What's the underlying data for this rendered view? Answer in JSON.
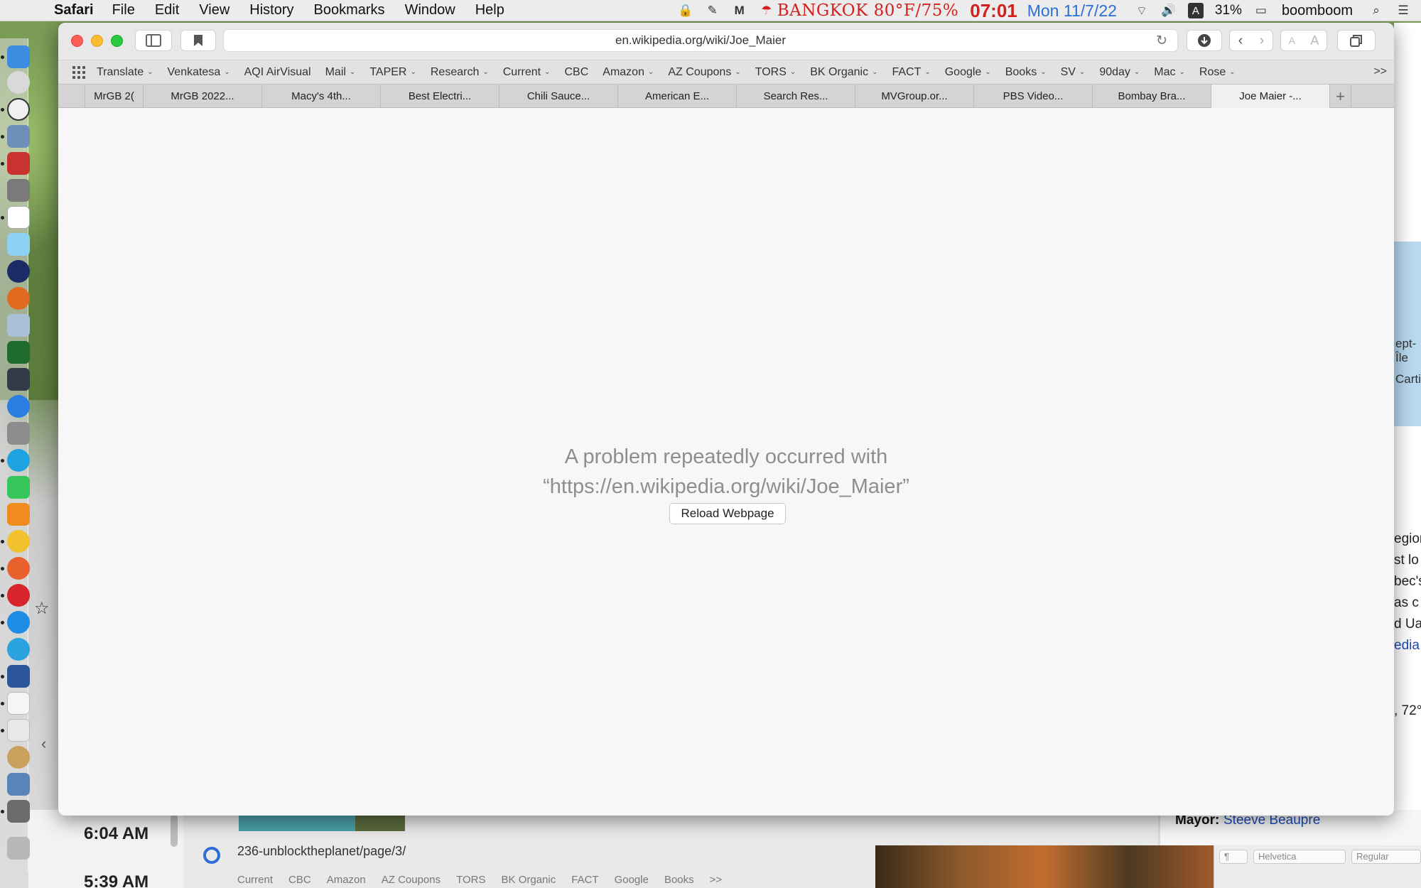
{
  "menubar": {
    "app_name": "Safari",
    "menus": [
      "File",
      "Edit",
      "View",
      "History",
      "Bookmarks",
      "Window",
      "Help"
    ],
    "weather": "BANGKOK 80°F/75%",
    "time": "07:01",
    "date": "Mon 11/7/22",
    "battery": "31%",
    "input_source": "A",
    "user": "boomboom"
  },
  "browser": {
    "url": "en.wikipedia.org/wiki/Joe_Maier",
    "bookmarks": [
      {
        "label": "Translate",
        "menu": true
      },
      {
        "label": "Venkatesa",
        "menu": true
      },
      {
        "label": "AQI AirVisual",
        "menu": false
      },
      {
        "label": "Mail",
        "menu": true
      },
      {
        "label": "TAPER",
        "menu": true
      },
      {
        "label": "Research",
        "menu": true
      },
      {
        "label": "Current",
        "menu": true
      },
      {
        "label": "CBC",
        "menu": false
      },
      {
        "label": "Amazon",
        "menu": true
      },
      {
        "label": "AZ Coupons",
        "menu": true
      },
      {
        "label": "TORS",
        "menu": true
      },
      {
        "label": "BK Organic",
        "menu": true
      },
      {
        "label": "FACT",
        "menu": true
      },
      {
        "label": "Google",
        "menu": true
      },
      {
        "label": "Books",
        "menu": true
      },
      {
        "label": "SV",
        "menu": true
      },
      {
        "label": "90day",
        "menu": true
      },
      {
        "label": "Mac",
        "menu": true
      },
      {
        "label": "Rose",
        "menu": true
      }
    ],
    "bookmarks_overflow": ">>",
    "tabs": [
      {
        "label": "",
        "active": false
      },
      {
        "label": "MrGB 2(",
        "active": false
      },
      {
        "label": "MrGB 2022...",
        "active": false
      },
      {
        "label": "Macy's 4th...",
        "active": false
      },
      {
        "label": "Best Electri...",
        "active": false
      },
      {
        "label": "Chili Sauce...",
        "active": false
      },
      {
        "label": "American E...",
        "active": false
      },
      {
        "label": "Search Res...",
        "active": false
      },
      {
        "label": "MVGroup.or...",
        "active": false
      },
      {
        "label": "PBS Video...",
        "active": false
      },
      {
        "label": "Bombay Bra...",
        "active": false
      },
      {
        "label": "Joe Maier -...",
        "active": true
      }
    ],
    "new_tab": "+",
    "error": {
      "line1": "A problem repeatedly occurred with",
      "line2": "“https://en.wikipedia.org/wiki/Joe_Maier”",
      "reload_label": "Reload Webpage"
    }
  },
  "background": {
    "times": [
      "6:04 AM",
      "5:39 AM"
    ],
    "partial_url": "236-unblocktheplanet/page/3/",
    "partial_bookmarks": [
      "Current",
      "CBC",
      "Amazon",
      "AZ Coupons",
      "TORS",
      "BK Organic",
      "FACT",
      "Google",
      "Books",
      ">>"
    ],
    "map_labels": [
      "ept-Île",
      "Cartie"
    ],
    "article_lines": [
      "egion",
      "st lo",
      "bec's",
      "as c",
      "d Ua"
    ],
    "article_link": "edia",
    "article_number": ", 72°",
    "mayor_label": "Mayor:",
    "mayor_value": "Steeve Beaupre",
    "format_font": "Helvetica",
    "format_style": "Regular"
  },
  "colors": {
    "weather": "#d41f1f",
    "time": "#d41f1f",
    "date": "#2b6fd6",
    "error_text": "#8e8e8e"
  }
}
